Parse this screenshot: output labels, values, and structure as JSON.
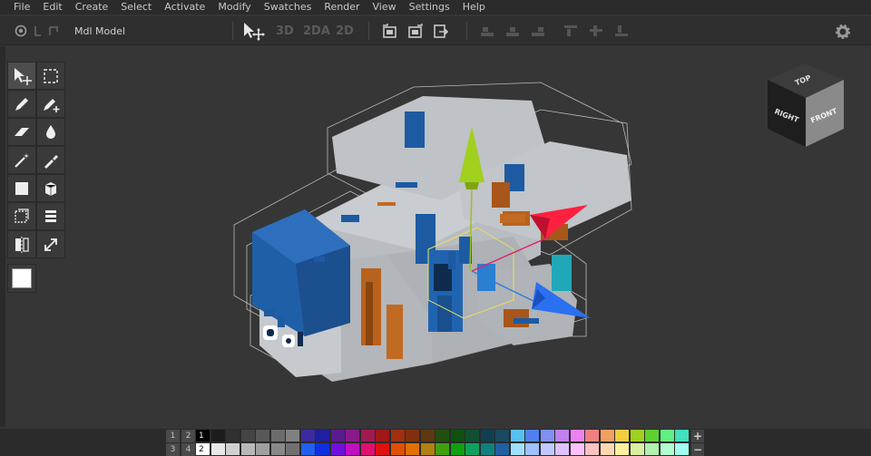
{
  "menu": [
    "File",
    "Edit",
    "Create",
    "Select",
    "Activate",
    "Modify",
    "Swatches",
    "Render",
    "View",
    "Settings",
    "Help"
  ],
  "toolbar": {
    "mode_label": "Mdl",
    "model_label": "Model",
    "view_modes": [
      "3D",
      "2DA",
      "2D"
    ]
  },
  "tools": [
    [
      "select-move-icon",
      "marquee-select-icon"
    ],
    [
      "pencil-icon",
      "pencil-plus-icon"
    ],
    [
      "eraser-icon",
      "paint-drop-icon"
    ],
    [
      "magic-wand-icon",
      "eyedropper-icon"
    ],
    [
      "square-fill-icon",
      "cube-icon"
    ],
    [
      "cube-outline-icon",
      "layers-icon"
    ],
    [
      "mirror-icon",
      "resize-arrows-icon"
    ]
  ],
  "current_color": "#ffffff",
  "viewcube": {
    "top": "TOP",
    "right": "RIGHT",
    "front": "FRONT"
  },
  "palette": {
    "pages": [
      [
        "1",
        "2"
      ],
      [
        "3",
        "4"
      ]
    ],
    "row1_labels": [
      "1"
    ],
    "row2_labels": [
      "2"
    ],
    "row1": [
      "#000000",
      "#1c1c1c",
      "#303030",
      "#444444",
      "#585858",
      "#6c6c6c",
      "#808080",
      "#3a2a9e",
      "#2020a0",
      "#5a1a90",
      "#8a1a8a",
      "#a01a50",
      "#a01818",
      "#a03010",
      "#803010",
      "#603810",
      "#205010",
      "#105010",
      "#105030",
      "#104050",
      "#1a4a60",
      "#58c0f0",
      "#5080f0",
      "#8090f0",
      "#c080f0",
      "#f080f0",
      "#f08080",
      "#f0a060",
      "#f0d040",
      "#a0d020",
      "#60d030",
      "#60f080",
      "#40e0c0"
    ],
    "row2": [
      "#ffffff",
      "#e8e8e8",
      "#d0d0d0",
      "#b8b8b8",
      "#a0a0a0",
      "#888888",
      "#707070",
      "#2060f0",
      "#1030e0",
      "#7010e0",
      "#c010c0",
      "#e01070",
      "#e01010",
      "#e05000",
      "#e07000",
      "#b08010",
      "#40a010",
      "#10a010",
      "#10a060",
      "#108080",
      "#2060a0",
      "#a0e0ff",
      "#a0c0ff",
      "#c0c8ff",
      "#e0c0ff",
      "#ffc0ff",
      "#ffc0c0",
      "#ffd8b0",
      "#fff0a0",
      "#d8f0a0",
      "#b0f0b0",
      "#b0ffd0",
      "#a0fff0"
    ],
    "plus": "+",
    "minus": "−"
  }
}
